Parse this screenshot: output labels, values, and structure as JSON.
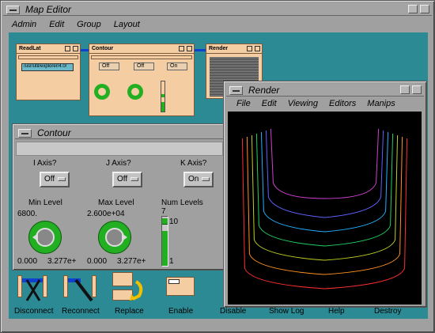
{
  "map_editor": {
    "title": "Map Editor",
    "menu": [
      "Admin",
      "Edit",
      "Group",
      "Layout"
    ]
  },
  "modules": {
    "readlat": {
      "title": "ReadLat",
      "path": "/usr/util/explorer/4.0/"
    },
    "contour": {
      "title": "Contour",
      "dd": [
        "Off",
        "Off",
        "On"
      ]
    },
    "render": {
      "title": "Render"
    }
  },
  "contour_panel": {
    "title": "Contour",
    "axes": [
      {
        "label": "I Axis?",
        "value": "Off"
      },
      {
        "label": "J Axis?",
        "value": "Off"
      },
      {
        "label": "K Axis?",
        "value": "On"
      }
    ],
    "min_level": {
      "label": "Min Level",
      "value": "6800.",
      "range_min": "0.000",
      "range_max": "3.277e+"
    },
    "max_level": {
      "label": "Max Level",
      "value": "2.600e+04",
      "range_min": "0.000",
      "range_max": "3.277e+"
    },
    "num_levels": {
      "label": "Num Levels",
      "value": "7",
      "max": "10",
      "min": "1",
      "level_fraction": 0.25
    }
  },
  "render_window": {
    "title": "Render",
    "menu": [
      "File",
      "Edit",
      "Viewing",
      "Editors",
      "Manips"
    ]
  },
  "toolbar": {
    "items": [
      "Disconnect",
      "Reconnect",
      "Replace",
      "Enable",
      "Disable",
      "Show Log",
      "Help",
      "Destroy"
    ]
  },
  "contour_colors": [
    "#d040d0",
    "#6060ff",
    "#20b0ff",
    "#20d060",
    "#c0d020",
    "#ff9020",
    "#ff3030"
  ]
}
